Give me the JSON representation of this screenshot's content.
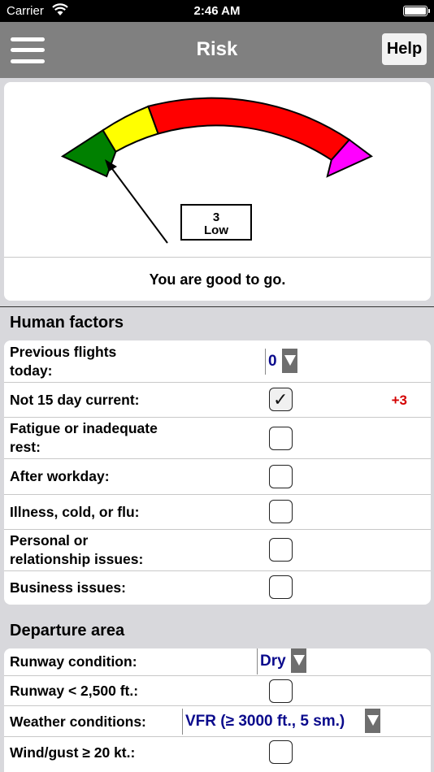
{
  "status_bar": {
    "carrier": "Carrier",
    "time": "2:46 AM"
  },
  "navbar": {
    "title": "Risk",
    "help_label": "Help"
  },
  "gauge": {
    "score": "3",
    "level": "Low",
    "message": "You are good to go.",
    "band_colors": [
      "#008000",
      "#ffff00",
      "#ff0000",
      "#ff00ff"
    ]
  },
  "human_factors": {
    "title": "Human factors",
    "rows": [
      {
        "label_lines": [
          "Previous flights",
          "today:"
        ],
        "type": "dropdown",
        "value": "0"
      },
      {
        "label_lines": [
          "Not 15 day current:"
        ],
        "type": "checkbox",
        "checked": true,
        "points": "+3"
      },
      {
        "label_lines": [
          "Fatigue or inadequate",
          "rest:"
        ],
        "type": "checkbox",
        "checked": false
      },
      {
        "label_lines": [
          "After workday:"
        ],
        "type": "checkbox",
        "checked": false
      },
      {
        "label_lines": [
          "Illness, cold, or flu:"
        ],
        "type": "checkbox",
        "checked": false
      },
      {
        "label_lines": [
          "Personal or",
          "relationship issues:"
        ],
        "type": "checkbox",
        "checked": false
      },
      {
        "label_lines": [
          "Business issues:"
        ],
        "type": "checkbox",
        "checked": false
      }
    ]
  },
  "departure_area": {
    "title": "Departure area",
    "rows": [
      {
        "label_lines": [
          "Runway condition:"
        ],
        "type": "dropdown",
        "value": "Dry"
      },
      {
        "label_lines": [
          "Runway < 2,500 ft.:"
        ],
        "type": "checkbox",
        "checked": false
      },
      {
        "label_lines": [
          "Weather conditions:"
        ],
        "type": "dropdown",
        "value": "VFR (≥ 3000 ft., 5 sm.)"
      },
      {
        "label_lines": [
          "Wind/gust ≥ 20 kt.:"
        ],
        "type": "checkbox",
        "checked": false
      }
    ]
  }
}
